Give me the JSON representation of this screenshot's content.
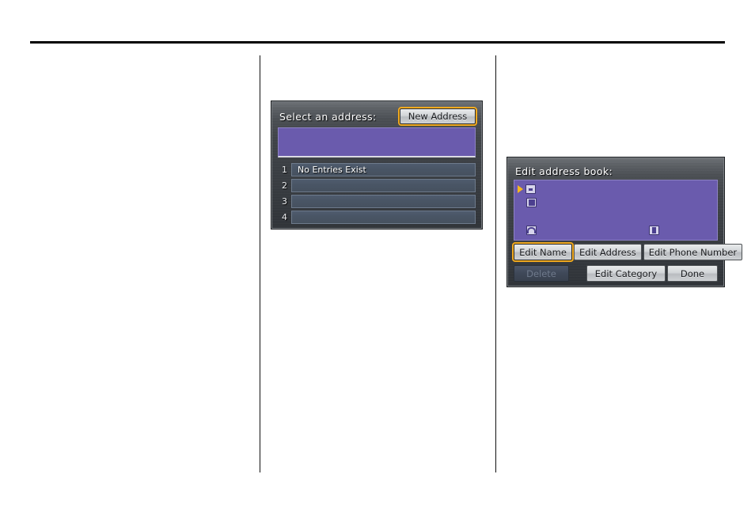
{
  "page": {
    "background_color": "#ffffff",
    "rule_color": "#000000"
  },
  "screens": [
    {
      "id": "address-list",
      "title": "Select an address:",
      "new_address_label": "New Address",
      "new_address_highlighted": true,
      "entry_panel_color": "#6a5bad",
      "list": [
        {
          "number": "1",
          "value": "No Entries Exist"
        },
        {
          "number": "2",
          "value": ""
        },
        {
          "number": "3",
          "value": ""
        },
        {
          "number": "4",
          "value": ""
        }
      ]
    },
    {
      "id": "edit-address-book",
      "title": "Edit address book:",
      "entry_panel_color": "#6a5bad",
      "cursor_color": "#f5b721",
      "fields": [
        {
          "icon": "name-icon",
          "value": "",
          "selected": true
        },
        {
          "icon": "address-icon",
          "value": "",
          "selected": false
        },
        {
          "icon": "phone-icon",
          "value": "",
          "selected": false
        },
        {
          "icon": "category-icon",
          "value": "",
          "selected": false
        }
      ],
      "buttons_row_1": [
        {
          "label": "Edit Name",
          "highlighted": true,
          "disabled": false
        },
        {
          "label": "Edit Address",
          "highlighted": false,
          "disabled": false
        },
        {
          "label": "Edit Phone Number",
          "highlighted": false,
          "disabled": false
        }
      ],
      "buttons_row_2": [
        {
          "label": "Delete",
          "highlighted": false,
          "disabled": true
        },
        {
          "label": "Edit Category",
          "highlighted": false,
          "disabled": false
        },
        {
          "label": "Done",
          "highlighted": false,
          "disabled": false
        }
      ]
    }
  ],
  "highlight_color": "#f0a91e"
}
